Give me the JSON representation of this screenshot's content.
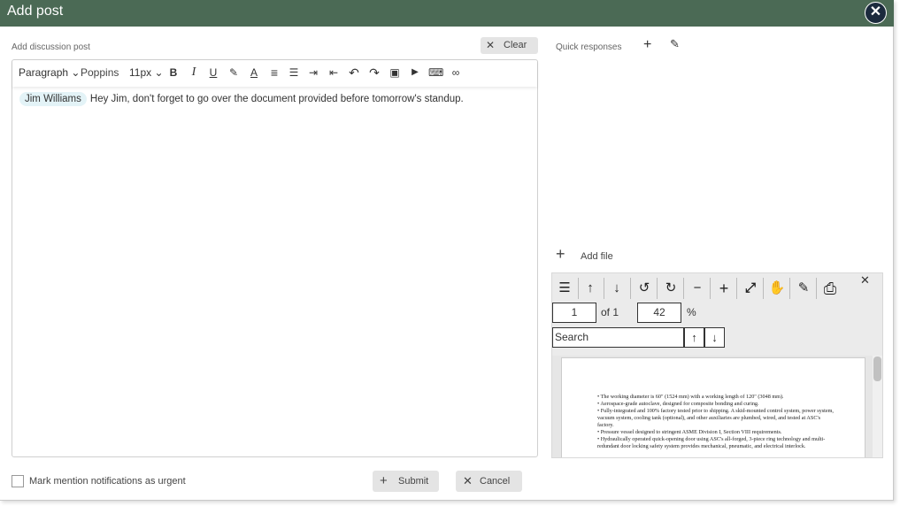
{
  "dialog": {
    "title": "Add post",
    "close_glyph": "✕"
  },
  "post": {
    "label": "Add discussion post",
    "clear_label": "Clear",
    "clear_glyph": "✕",
    "toolbar": {
      "paragraph": "Paragraph",
      "font": "Poppins",
      "size": "11px",
      "chevron": "⌄",
      "icons": [
        "bold-icon",
        "italic-icon",
        "underline-icon",
        "highlight-icon",
        "font-color-icon",
        "align-left-icon",
        "bullet-list-icon",
        "indent-icon",
        "outdent-icon",
        "undo-icon",
        "redo-icon",
        "image-icon",
        "video-icon",
        "embed-icon",
        "link-icon"
      ],
      "glyphs": {
        "bold": "B",
        "italic": "I",
        "underline": "U",
        "highlight": "✎",
        "fontcolor": "A",
        "align": "≡",
        "list": "☰",
        "indent": "⇥",
        "outdent": "⇤",
        "undo": "↶",
        "redo": "↷",
        "image": "▣",
        "video": "▶",
        "embed": "⌨",
        "link": "∞"
      }
    },
    "mention": "Jim Williams",
    "message": "Hey Jim, don't forget to go over the document provided  before tomorrow's standup."
  },
  "quick_responses": {
    "label": "Quick responses",
    "add_glyph": "+",
    "edit_glyph": "✎"
  },
  "add_file": {
    "label": "Add file",
    "glyph": "+"
  },
  "viewer": {
    "close_glyph": "✕",
    "tools": {
      "menu": "☰",
      "up": "↑",
      "down": "↓",
      "rotate_left": "↺",
      "rotate_right": "↻",
      "zoom_out": "−",
      "zoom_in": "+",
      "fit": "⤢",
      "hand": "✋",
      "annotate": "✎",
      "print": "⎙"
    },
    "page": "1",
    "of_label": "of 1",
    "zoom": "42",
    "zoom_unit": "%",
    "search_value": "Search",
    "search_up": "↑",
    "search_down": "↓",
    "doc_lines": [
      "•  The working diameter is 60\" (1524 mm) with a working length of 120\" (3048 mm).",
      "•  Aerospace-grade autoclave, designed for composite bonding and curing.",
      "•  Fully-integrated and 100% factory tested prior to shipping. A skid-mounted control system, power system, vacuum system, cooling tank (optional), and other auxiliaries are plumbed, wired, and tested at ASC's factory.",
      "•  Pressure vessel designed to stringent ASME Division I, Section VIII requirements.",
      "•  Hydraulically operated quick-opening door using ASC's all-forged, 3-piece ring technology and multi-redundant door locking safety system provides mechanical, pneumatic, and electrical interlock."
    ]
  },
  "footer": {
    "urgent_label": "Mark mention notifications as urgent",
    "submit_label": "Submit",
    "submit_glyph": "+",
    "cancel_label": "Cancel",
    "cancel_glyph": "✕"
  }
}
